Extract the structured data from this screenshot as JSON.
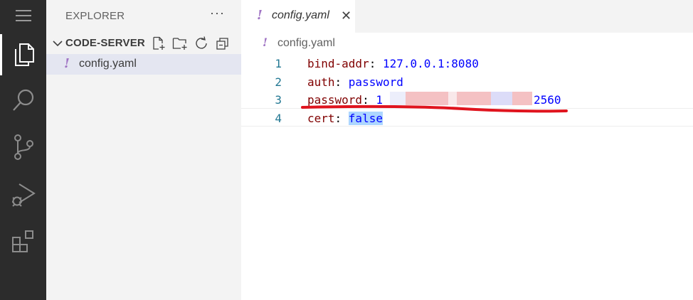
{
  "activity_bar": {
    "items": [
      {
        "icon": "menu-icon"
      },
      {
        "icon": "files-icon",
        "active": true
      },
      {
        "icon": "search-icon"
      },
      {
        "icon": "source-control-icon"
      },
      {
        "icon": "run-debug-icon"
      },
      {
        "icon": "extensions-icon"
      }
    ]
  },
  "sidebar": {
    "title": "EXPLORER",
    "more": "···",
    "section_title": "CODE-SERVER",
    "actions": [
      "new-file-icon",
      "new-folder-icon",
      "refresh-icon",
      "collapse-all-icon"
    ],
    "files": [
      {
        "name": "config.yaml",
        "icon": "!"
      }
    ]
  },
  "tabs": [
    {
      "label": "config.yaml",
      "icon": "!",
      "close": "✕"
    }
  ],
  "breadcrumb": {
    "icon": "!",
    "label": "config.yaml"
  },
  "editor": {
    "lines": [
      {
        "number": "1",
        "key": "bind-addr",
        "sep": ": ",
        "value": "127.0.0.1:8080"
      },
      {
        "number": "2",
        "key": "auth",
        "sep": ": ",
        "value": "password"
      },
      {
        "number": "3",
        "key": "password",
        "sep": ": ",
        "value_start": "1",
        "value_end": "2560"
      },
      {
        "number": "4",
        "key": "cert",
        "sep": ": ",
        "value": "false"
      }
    ]
  },
  "colors": {
    "activity_bg": "#2c2c2c",
    "sidebar_bg": "#f3f3f3",
    "yaml_icon": "#a074c4",
    "annotation_red": "#e0141e"
  }
}
